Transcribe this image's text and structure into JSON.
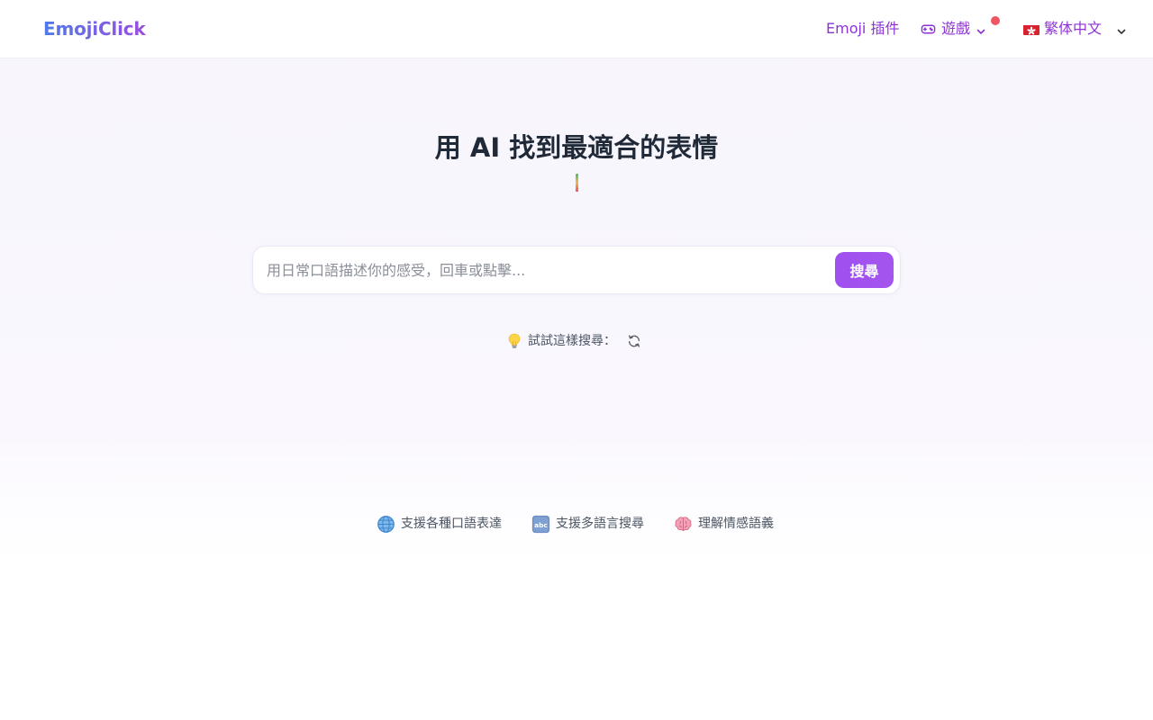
{
  "header": {
    "logo": "EmojiClick",
    "nav": {
      "plugin_label": "Emoji 插件",
      "games_label": "遊戲",
      "language_label": "繁体中文"
    },
    "icons": {
      "games": "gamepad-icon",
      "games_dropdown": "chevron-down-icon",
      "notification": "notification-dot",
      "language_flag": "hong-kong-flag-icon",
      "language_dropdown": "chevron-down-icon"
    }
  },
  "hero": {
    "title": "用 AI 找到最適合的表情"
  },
  "search": {
    "placeholder": "用日常口語描述你的感受，回車或點擊...",
    "value": "",
    "button_label": "搜尋"
  },
  "suggestions": {
    "label": "試試這樣搜尋：",
    "icons": {
      "lead": "light-bulb-icon",
      "refresh": "refresh-icon"
    }
  },
  "features": [
    {
      "icon": "globe-icon",
      "label": "支援各種口語表達"
    },
    {
      "icon": "abc-icon",
      "label": "支援多語言搜尋"
    },
    {
      "icon": "brain-icon",
      "label": "理解情感語義"
    }
  ],
  "colors": {
    "brand_gradient_start": "#4f7be6",
    "brand_gradient_end": "#9b4de0",
    "nav_text": "#8e34d6",
    "button": "#a04ff0",
    "notification": "#ef5563"
  }
}
